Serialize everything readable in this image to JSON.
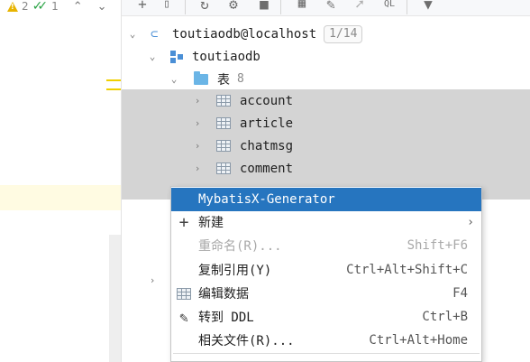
{
  "editor": {
    "warnings_count": "2",
    "checks_count": "1"
  },
  "tree": {
    "connection": "toutiaodb@localhost",
    "connection_badge": "1/14",
    "schema": "toutiaodb",
    "tables_folder": "表",
    "tables_count": "8",
    "tables": [
      "account",
      "article",
      "chatmsg",
      "comment"
    ]
  },
  "context_menu": {
    "items": [
      {
        "label": "MybatisX-Generator",
        "shortcut": "",
        "state": "active"
      },
      {
        "label": "新建",
        "shortcut": "",
        "state": "normal",
        "submenu": true
      },
      {
        "label": "重命名(R)...",
        "shortcut": "Shift+F6",
        "state": "disabled"
      },
      {
        "label": "复制引用(Y)",
        "shortcut": "Ctrl+Alt+Shift+C",
        "state": "normal"
      },
      {
        "label": "编辑数据",
        "shortcut": "F4",
        "state": "normal"
      },
      {
        "label": "转到 DDL",
        "shortcut": "Ctrl+B",
        "state": "normal"
      },
      {
        "label": "相关文件(R)...",
        "shortcut": "Ctrl+Alt+Home",
        "state": "normal"
      },
      {
        "label": "",
        "shortcut": "",
        "state": "normal"
      }
    ]
  },
  "colors": {
    "menu_highlight": "#2675bf",
    "selection_gray": "#d4d4d4",
    "warning": "#e8b400",
    "check": "#29a344"
  }
}
